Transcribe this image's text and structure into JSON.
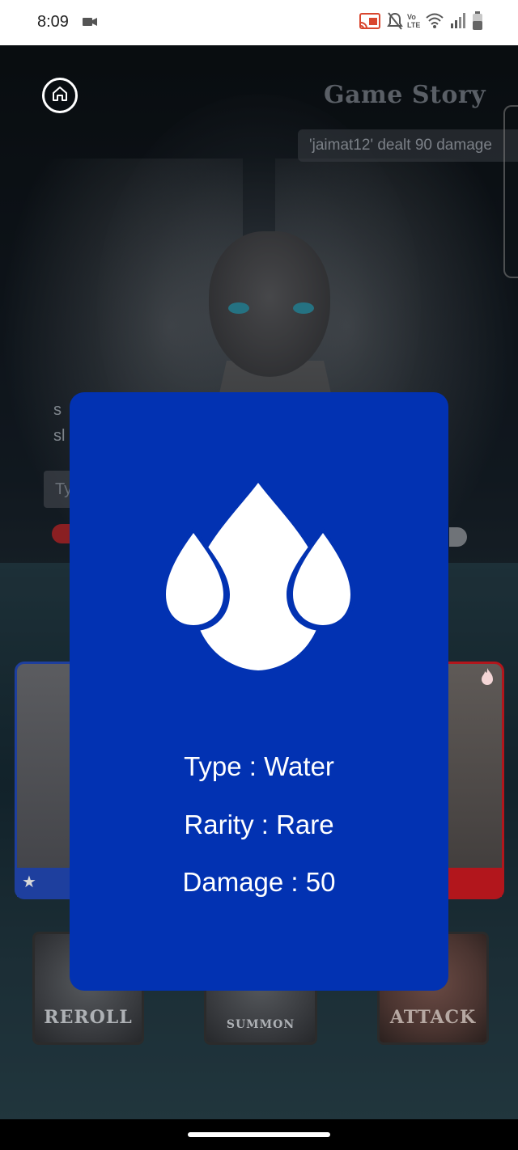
{
  "status_bar": {
    "time": "8:09",
    "icons": [
      "video-camera-icon",
      "cast-icon",
      "bell-off-icon",
      "volte-icon",
      "wifi-icon",
      "signal-icon",
      "battery-icon"
    ],
    "volte_label": "Vo LTE"
  },
  "header": {
    "home_icon": "home-icon",
    "title": "Game Story",
    "log_text": "'jaimat12' dealt 90 damage"
  },
  "chat": {
    "peek_line_1": "s",
    "peek_line_2": "sl",
    "input_placeholder": "Ty"
  },
  "actions": {
    "reroll_label": "REROLL",
    "summon_label": "SUMMON",
    "attack_label": "ATTACK"
  },
  "card_modal": {
    "icon": "water-drops-icon",
    "type": "Type : Water",
    "rarity": "Rarity : Rare",
    "damage": "Damage : 50",
    "color": "#0232b2"
  },
  "colors": {
    "player_card_border": "#1e3f9e",
    "opponent_card_border": "#b2161c"
  }
}
